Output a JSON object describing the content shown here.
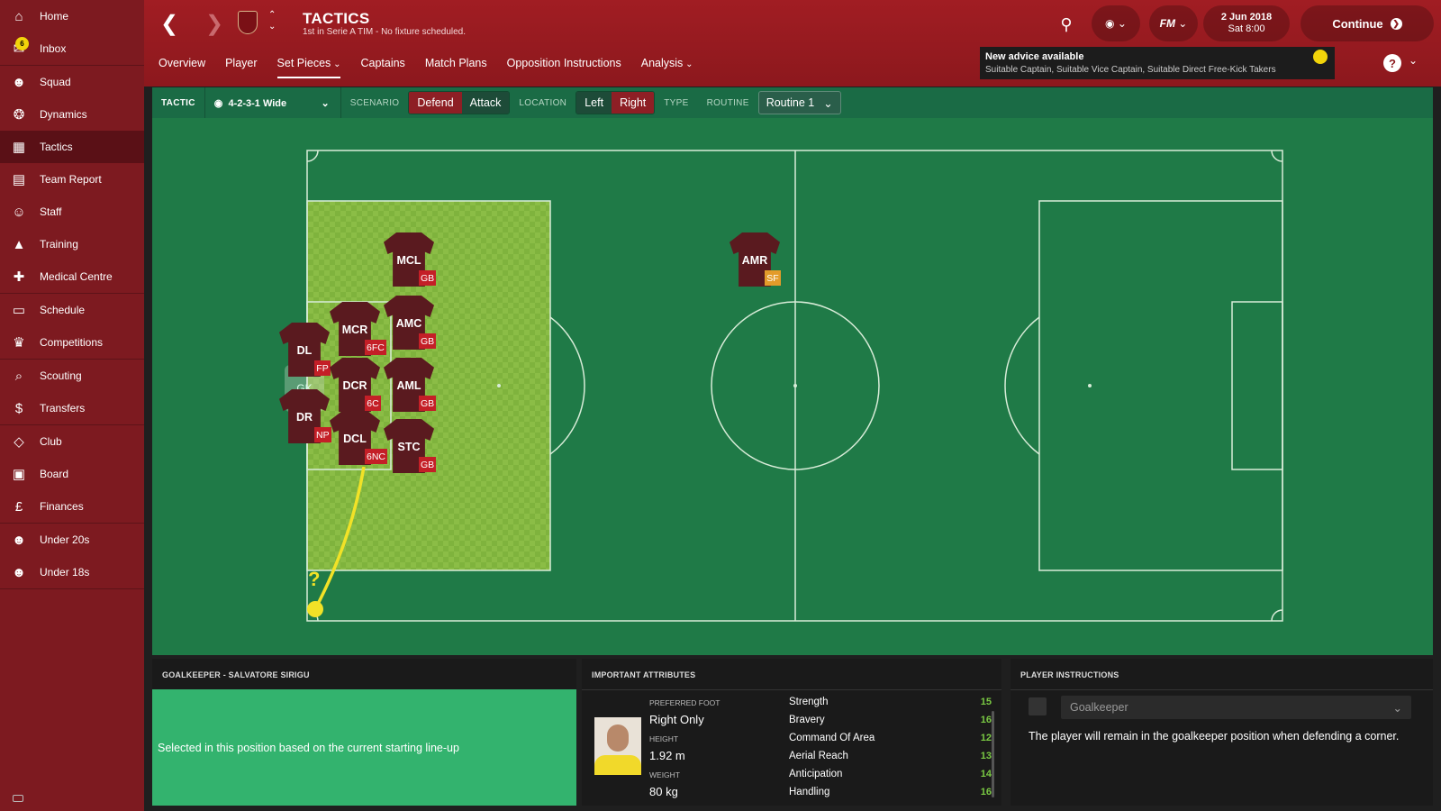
{
  "sidebar": {
    "items": [
      {
        "label": "Home",
        "icon": "home-icon",
        "glyph": "⌂"
      },
      {
        "label": "Inbox",
        "icon": "inbox-icon",
        "glyph": "✉",
        "badge": "6"
      },
      {
        "label": "Squad",
        "icon": "squad-icon",
        "glyph": "☻"
      },
      {
        "label": "Dynamics",
        "icon": "dynamics-icon",
        "glyph": "❂"
      },
      {
        "label": "Tactics",
        "icon": "tactics-icon",
        "glyph": "▦",
        "active": true
      },
      {
        "label": "Team Report",
        "icon": "team-report-icon",
        "glyph": "▤"
      },
      {
        "label": "Staff",
        "icon": "staff-icon",
        "glyph": "☺"
      },
      {
        "label": "Training",
        "icon": "training-icon",
        "glyph": "▲"
      },
      {
        "label": "Medical Centre",
        "icon": "medical-icon",
        "glyph": "✚"
      },
      {
        "label": "Schedule",
        "icon": "schedule-icon",
        "glyph": "▭"
      },
      {
        "label": "Competitions",
        "icon": "trophy-icon",
        "glyph": "♛"
      },
      {
        "label": "Scouting",
        "icon": "search-icon",
        "glyph": "⌕"
      },
      {
        "label": "Transfers",
        "icon": "transfers-icon",
        "glyph": "$"
      },
      {
        "label": "Club",
        "icon": "club-icon",
        "glyph": "◇"
      },
      {
        "label": "Board",
        "icon": "board-icon",
        "glyph": "▣"
      },
      {
        "label": "Finances",
        "icon": "finances-icon",
        "glyph": "£"
      },
      {
        "label": "Under 20s",
        "icon": "under20-icon",
        "glyph": "☻"
      },
      {
        "label": "Under 18s",
        "icon": "under18-icon",
        "glyph": "☻"
      }
    ]
  },
  "header": {
    "title": "TACTICS",
    "subtitle": "1st in Serie A TIM - No fixture scheduled.",
    "date": "2 Jun 2018",
    "time": "Sat 8:00",
    "continue": "Continue",
    "fm": "FM",
    "advice_title": "New advice available",
    "advice_text": "Suitable Captain, Suitable Vice Captain, Suitable Direct Free-Kick Takers",
    "help": "?"
  },
  "tabs": [
    {
      "label": "Overview"
    },
    {
      "label": "Player"
    },
    {
      "label": "Set Pieces",
      "active": true
    },
    {
      "label": "Captains"
    },
    {
      "label": "Match Plans"
    },
    {
      "label": "Opposition Instructions"
    },
    {
      "label": "Analysis"
    }
  ],
  "toolbar": {
    "tactic_label": "TACTIC",
    "tactic_value": "4-2-3-1 Wide",
    "scenario_label": "SCENARIO",
    "defend": "Defend",
    "attack": "Attack",
    "location_label": "LOCATION",
    "left": "Left",
    "right": "Right",
    "type_label": "TYPE",
    "routine_label": "ROUTINE",
    "routine_value": "Routine 1"
  },
  "players": [
    {
      "pos": "MCL",
      "tag": "GB"
    },
    {
      "pos": "AMR",
      "tag": "SF"
    },
    {
      "pos": "MCR",
      "tag": "6FC"
    },
    {
      "pos": "AMC",
      "tag": "GB"
    },
    {
      "pos": "DL",
      "tag": "FP"
    },
    {
      "pos": "DCR",
      "tag": "6C"
    },
    {
      "pos": "AML",
      "tag": "GB"
    },
    {
      "pos": "DR",
      "tag": "NP"
    },
    {
      "pos": "DCL",
      "tag": "6NC"
    },
    {
      "pos": "STC",
      "tag": "GB"
    }
  ],
  "gk_marker": "GK",
  "ball_marker": "?",
  "selected_panel": {
    "title": "GOALKEEPER - SALVATORE SIRIGU",
    "text": "Selected in this position based on the current starting line-up"
  },
  "attributes_panel": {
    "title": "IMPORTANT ATTRIBUTES",
    "preferred_foot_label": "PREFERRED FOOT",
    "preferred_foot": "Right Only",
    "height_label": "HEIGHT",
    "height": "1.92 m",
    "weight_label": "WEIGHT",
    "weight": "80 kg",
    "attributes": [
      {
        "name": "Strength",
        "value": "15"
      },
      {
        "name": "Bravery",
        "value": "16"
      },
      {
        "name": "Command Of Area",
        "value": "12"
      },
      {
        "name": "Aerial Reach",
        "value": "13"
      },
      {
        "name": "Anticipation",
        "value": "14"
      },
      {
        "name": "Handling",
        "value": "16"
      }
    ]
  },
  "instructions_panel": {
    "title": "PLAYER INSTRUCTIONS",
    "select_value": "Goalkeeper",
    "text": "The player will remain in the goalkeeper position when defending a corner."
  }
}
